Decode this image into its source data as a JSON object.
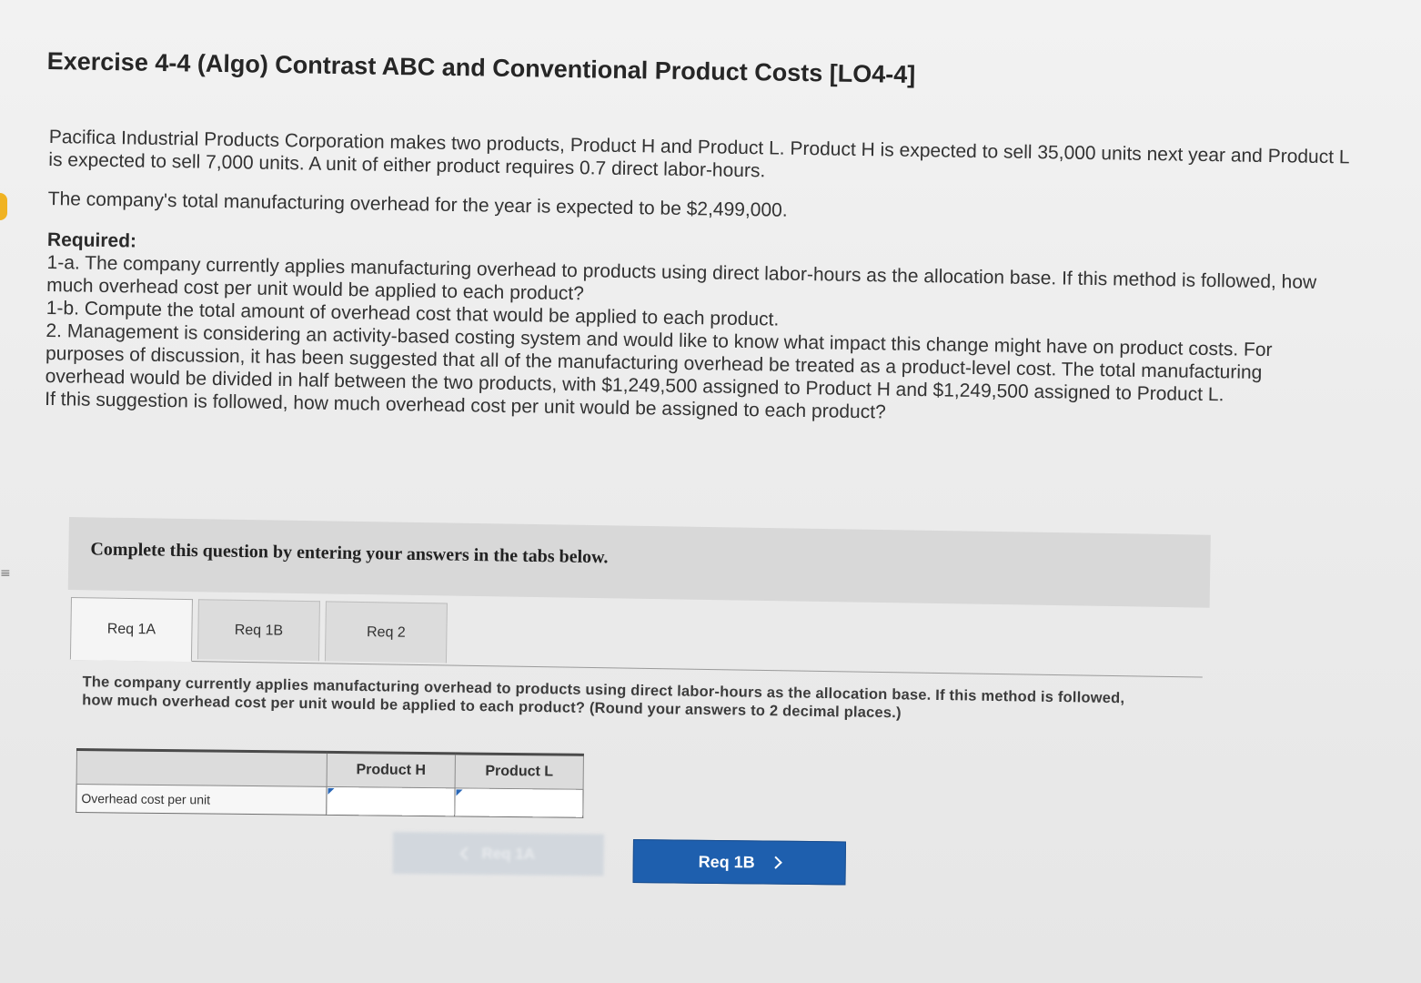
{
  "exercise": {
    "title": "Exercise 4-4 (Algo) Contrast ABC and Conventional Product Costs [LO4-4]"
  },
  "problem": {
    "paragraph1": "Pacifica Industrial Products Corporation makes two products, Product H and Product L. Product H is expected to sell 35,000 units next year and Product L is expected to sell 7,000 units. A unit of either product requires 0.7 direct labor-hours.",
    "paragraph2": "The company's total manufacturing overhead for the year is expected to be $2,499,000.",
    "required_heading": "Required:",
    "req_1a": "1-a. The company currently applies manufacturing overhead to products using direct labor-hours as the allocation base. If this method is followed, how much overhead cost per unit would be applied to each product?",
    "req_1b": "1-b. Compute the total amount of overhead cost that would be applied to each product.",
    "req_2": "2. Management is considering an activity-based costing system and would like to know what impact this change might have on product costs. For purposes of discussion, it has been suggested that all of the manufacturing overhead be treated as a product-level cost. The total manufacturing overhead would be divided in half between the two products, with $1,249,500 assigned to Product H and $1,249,500 assigned to Product L.",
    "req_2_followup": "If this suggestion is followed, how much overhead cost per unit would be assigned to each product?"
  },
  "instructions": "Complete this question by entering your answers in the tabs below.",
  "tabs": [
    {
      "label": "Req 1A",
      "active": true
    },
    {
      "label": "Req 1B",
      "active": false
    },
    {
      "label": "Req 2",
      "active": false
    }
  ],
  "active_question": "The company currently applies manufacturing overhead to products using direct labor-hours as the allocation base. If this method is followed, how much overhead cost per unit would be applied to each product? (Round your answers to 2 decimal places.)",
  "answer_table": {
    "columns": [
      "Product H",
      "Product L"
    ],
    "row_label": "Overhead cost per unit",
    "values": [
      "",
      ""
    ]
  },
  "navigation": {
    "prev_label": "Req 1A",
    "next_label": "Req 1B"
  },
  "side": {
    "glyph": "≡"
  },
  "colors": {
    "next_button": "#1e5fae",
    "prev_button_disabled": "#cfd5dc",
    "marker": "#f0b323"
  }
}
